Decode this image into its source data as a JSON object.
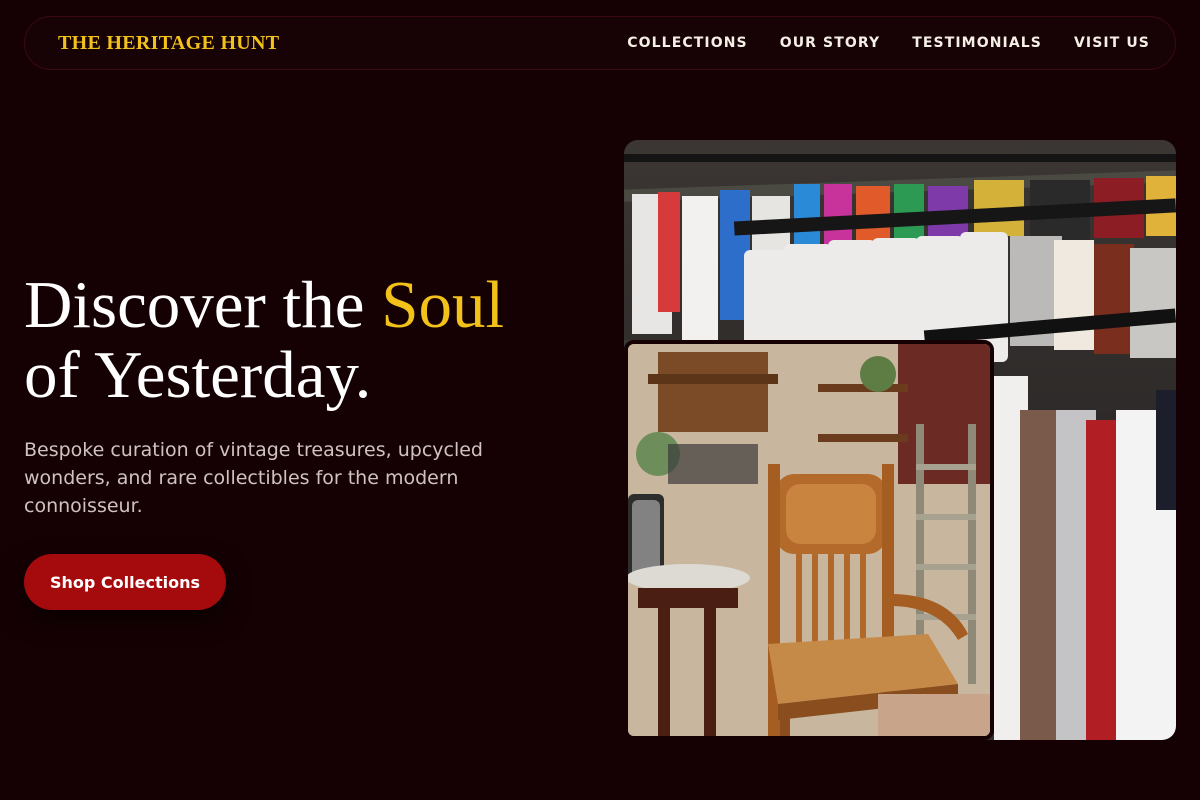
{
  "nav": {
    "brand": "THE HERITAGE HUNT",
    "links": [
      "COLLECTIONS",
      "OUR STORY",
      "TESTIMONIALS",
      "VISIT US"
    ]
  },
  "hero": {
    "headline_part1": "Discover the ",
    "headline_accent": "Soul",
    "headline_part2": "of Yesterday.",
    "subtext": "Bespoke curation of vintage treasures, upcycled wonders, and rare collectibles for the modern connoisseur.",
    "cta_label": "Shop Collections"
  },
  "colors": {
    "background": "#150103",
    "accent_gold": "#f2c21b",
    "cta_red": "#a50a0c"
  },
  "images": {
    "back": "clothing-rack-photo",
    "front": "antique-chair-shop-photo"
  }
}
